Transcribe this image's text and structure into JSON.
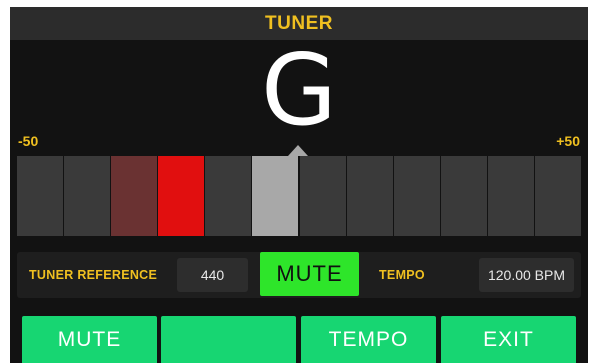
{
  "header": {
    "title": "TUNER"
  },
  "tuner": {
    "note": "G",
    "scale_min": "-50",
    "scale_max": "+50",
    "segments": [
      "off",
      "off",
      "dim-red",
      "red",
      "off",
      "center",
      "off",
      "off",
      "off",
      "off",
      "off",
      "off"
    ],
    "colors": {
      "off": "#3a3a3a",
      "dim-red": "#6a3232",
      "red": "#e10f0f",
      "center": "#a8a8a8"
    }
  },
  "controls": {
    "reference_label": "TUNER REFERENCE",
    "reference_value": "440",
    "mute_label": "MUTE",
    "tempo_label": "TEMPO",
    "tempo_value": "120.00 BPM"
  },
  "softkeys": [
    {
      "label": "MUTE"
    },
    {
      "label": ""
    },
    {
      "label": "TEMPO"
    },
    {
      "label": "EXIT"
    }
  ],
  "theme": {
    "accent": "#f0c020",
    "mute_green": "#2ee52a",
    "softkey_green": "#17d672"
  }
}
